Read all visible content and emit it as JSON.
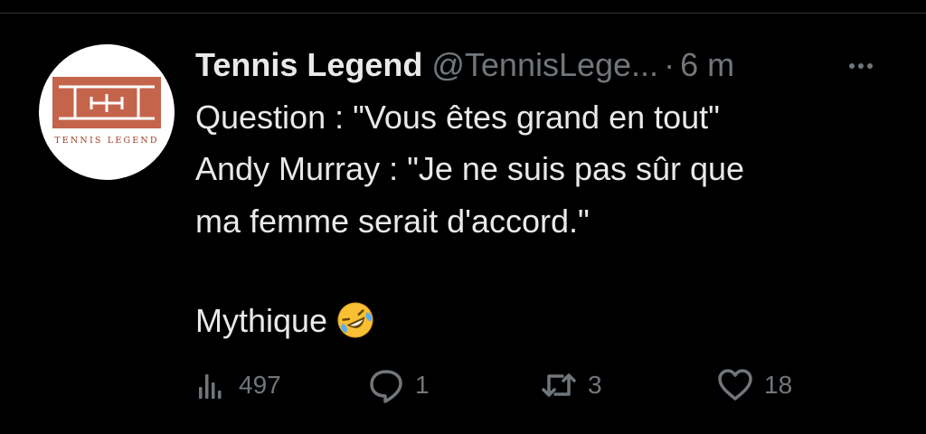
{
  "tweet": {
    "author_name": "Tennis Legend",
    "handle": "@TennisLege...",
    "separator": "·",
    "time": "6 m",
    "avatar_text": "TENNIS LEGEND",
    "text_lines": [
      "Question : \"Vous êtes grand en tout\"",
      "Andy Murray : \"Je ne suis pas sûr que",
      "ma femme serait d'accord.\"",
      "Mythique"
    ],
    "emoji": "rolling-on-the-floor-laughing"
  },
  "actions": {
    "views": "497",
    "replies": "1",
    "retweets": "3",
    "likes": "18"
  },
  "colors": {
    "background": "#000000",
    "text": "#e7e9ea",
    "secondary": "#71767b",
    "logo": "#c4644a"
  }
}
